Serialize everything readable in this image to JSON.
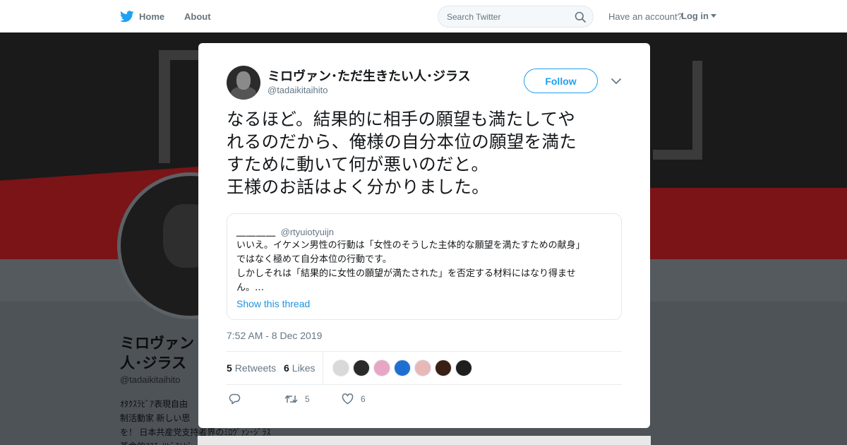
{
  "nav": {
    "home_label": "Home",
    "about_label": "About",
    "search_placeholder": "Search Twitter",
    "have_account": "Have an account?",
    "login_label": "Log in",
    "icons": {
      "home": "twitter-bird-icon",
      "search": "search-icon",
      "close": "close-icon"
    }
  },
  "profile": {
    "name_line1": "ミロヴァン",
    "name_line2": "人･ジラス",
    "handle": "@tadaikitaihito",
    "bio_line1": "ｵﾀｸｽﾗﾋﾞｱ表現自由",
    "bio_line2": "制活動家 新しい思",
    "bio_line3": "を！ 日本共産党支持者界のﾐﾛｳﾞｧﾝ･ｼﾞﾗｽ",
    "bio_line4": "革命的ｱｽﾁｰﾘﾋﾞｽﾑﾋﾞ"
  },
  "tweet": {
    "author_name": "ミロヴァン･ただ生きたい人･ジラス",
    "author_handle": "@tadaikitaihito",
    "follow_label": "Follow",
    "text_lines": [
      "なるほど。結果的に相手の願望も満たしてや",
      "れるのだから、俺様の自分本位の願望を満た",
      "すために動いて何が悪いのだと。",
      "王様のお話はよく分かりました。"
    ],
    "quote": {
      "name": "＿＿＿＿",
      "handle": "@rtyuiotyuijn",
      "lines": [
        "いいえ。イケメン男性の行動は「女性のそうした主体的な願望を満たすための献身」",
        "ではなく極めて自分本位の行動です。",
        "しかしそれは「結果的に女性の願望が満たされた」を否定する材料にはなり得ませ",
        "ん。…"
      ],
      "show_thread": "Show this thread"
    },
    "timestamp": "7:52 AM - 8 Dec 2019",
    "retweets_count": "5",
    "retweets_label": "Retweets",
    "likes_count": "6",
    "likes_label": "Likes",
    "action_retweet_count": "5",
    "action_like_count": "6",
    "liker_colors": [
      "#d9d9d9",
      "#2a2a2a",
      "#e8a6c4",
      "#1f6fd1",
      "#e8b8b8",
      "#3a1f14",
      "#1e1e1e"
    ]
  },
  "colors": {
    "accent": "#1da1f2",
    "link": "#1b95e0",
    "muted": "#657786",
    "nav_text": "#66757f"
  }
}
